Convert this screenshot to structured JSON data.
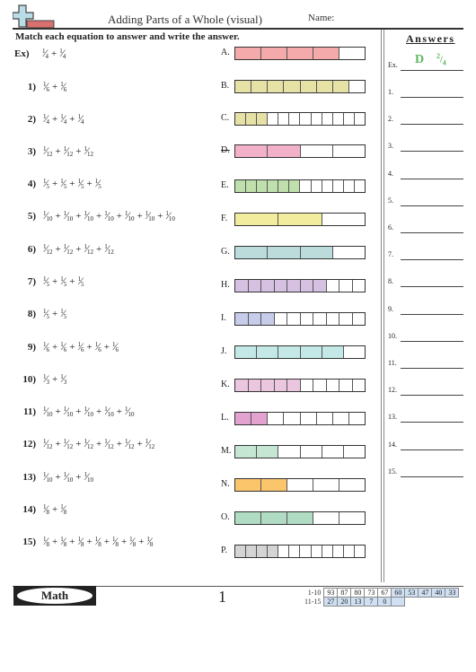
{
  "header": {
    "title": "Adding Parts of a Whole (visual)",
    "name_label": "Name:",
    "instructions": "Match each equation to answer and write the answer."
  },
  "problems": [
    {
      "label": "Ex)",
      "denominator": "4",
      "count": 2
    },
    {
      "label": "1)",
      "denominator": "6",
      "count": 2
    },
    {
      "label": "2)",
      "denominator": "4",
      "count": 3
    },
    {
      "label": "3)",
      "denominator": "12",
      "count": 3
    },
    {
      "label": "4)",
      "denominator": "5",
      "count": 4
    },
    {
      "label": "5)",
      "denominator": "10",
      "count": 7
    },
    {
      "label": "6)",
      "denominator": "12",
      "count": 4
    },
    {
      "label": "7)",
      "denominator": "5",
      "count": 3
    },
    {
      "label": "8)",
      "denominator": "5",
      "count": 2
    },
    {
      "label": "9)",
      "denominator": "6",
      "count": 5
    },
    {
      "label": "10)",
      "denominator": "3",
      "count": 2
    },
    {
      "label": "11)",
      "denominator": "10",
      "count": 5
    },
    {
      "label": "12)",
      "denominator": "12",
      "count": 6
    },
    {
      "label": "13)",
      "denominator": "10",
      "count": 3
    },
    {
      "label": "14)",
      "denominator": "8",
      "count": 2
    },
    {
      "label": "15)",
      "denominator": "8",
      "count": 7
    }
  ],
  "bars": [
    {
      "label": "A.",
      "segments": 5,
      "filled": 4,
      "color": "#f4a9aa",
      "struck": false
    },
    {
      "label": "B.",
      "segments": 8,
      "filled": 7,
      "color": "#e6e2a6",
      "struck": false
    },
    {
      "label": "C.",
      "segments": 12,
      "filled": 3,
      "color": "#e6e2a6",
      "struck": false
    },
    {
      "label": "D.",
      "segments": 4,
      "filled": 2,
      "color": "#f2b1c9",
      "struck": true
    },
    {
      "label": "E.",
      "segments": 12,
      "filled": 6,
      "color": "#bfe0ad",
      "struck": false
    },
    {
      "label": "F.",
      "segments": 3,
      "filled": 2,
      "color": "#f2ed9e",
      "struck": false
    },
    {
      "label": "G.",
      "segments": 4,
      "filled": 3,
      "color": "#bcdcdc",
      "struck": false
    },
    {
      "label": "H.",
      "segments": 10,
      "filled": 7,
      "color": "#d6c1e2",
      "struck": false
    },
    {
      "label": "I.",
      "segments": 10,
      "filled": 3,
      "color": "#c8cceb",
      "struck": false
    },
    {
      "label": "J.",
      "segments": 6,
      "filled": 5,
      "color": "#c4e8e6",
      "struck": false
    },
    {
      "label": "K.",
      "segments": 10,
      "filled": 5,
      "color": "#ebc6df",
      "struck": false
    },
    {
      "label": "L.",
      "segments": 8,
      "filled": 2,
      "color": "#e3a3d0",
      "struck": false
    },
    {
      "label": "M.",
      "segments": 6,
      "filled": 2,
      "color": "#c6e6d4",
      "struck": false
    },
    {
      "label": "N.",
      "segments": 5,
      "filled": 2,
      "color": "#fbc56b",
      "struck": false
    },
    {
      "label": "O.",
      "segments": 5,
      "filled": 3,
      "color": "#b0dcc4",
      "struck": false
    },
    {
      "label": "P.",
      "segments": 12,
      "filled": 4,
      "color": "#d4d4d4",
      "struck": false
    }
  ],
  "answers": {
    "title": "Answers",
    "example": {
      "label": "Ex.",
      "letter": "D",
      "numerator": "2",
      "denominator": "4"
    },
    "rows": [
      "1.",
      "2.",
      "3.",
      "4.",
      "5.",
      "6.",
      "7.",
      "8.",
      "9.",
      "10.",
      "11.",
      "12.",
      "13.",
      "14.",
      "15."
    ]
  },
  "footer": {
    "subject": "Math",
    "page": "1",
    "score_rows": [
      {
        "label": "1-10",
        "cells": [
          {
            "v": "93",
            "hl": false
          },
          {
            "v": "87",
            "hl": false
          },
          {
            "v": "80",
            "hl": false
          },
          {
            "v": "73",
            "hl": false
          },
          {
            "v": "67",
            "hl": false
          },
          {
            "v": "60",
            "hl": true
          },
          {
            "v": "53",
            "hl": true
          },
          {
            "v": "47",
            "hl": true
          },
          {
            "v": "40",
            "hl": true
          },
          {
            "v": "33",
            "hl": true
          }
        ]
      },
      {
        "label": "11-15",
        "cells": [
          {
            "v": "27",
            "hl": true
          },
          {
            "v": "20",
            "hl": true
          },
          {
            "v": "13",
            "hl": true
          },
          {
            "v": "7",
            "hl": true
          },
          {
            "v": "0",
            "hl": true
          },
          {
            "v": "",
            "hl": true
          }
        ]
      }
    ]
  }
}
